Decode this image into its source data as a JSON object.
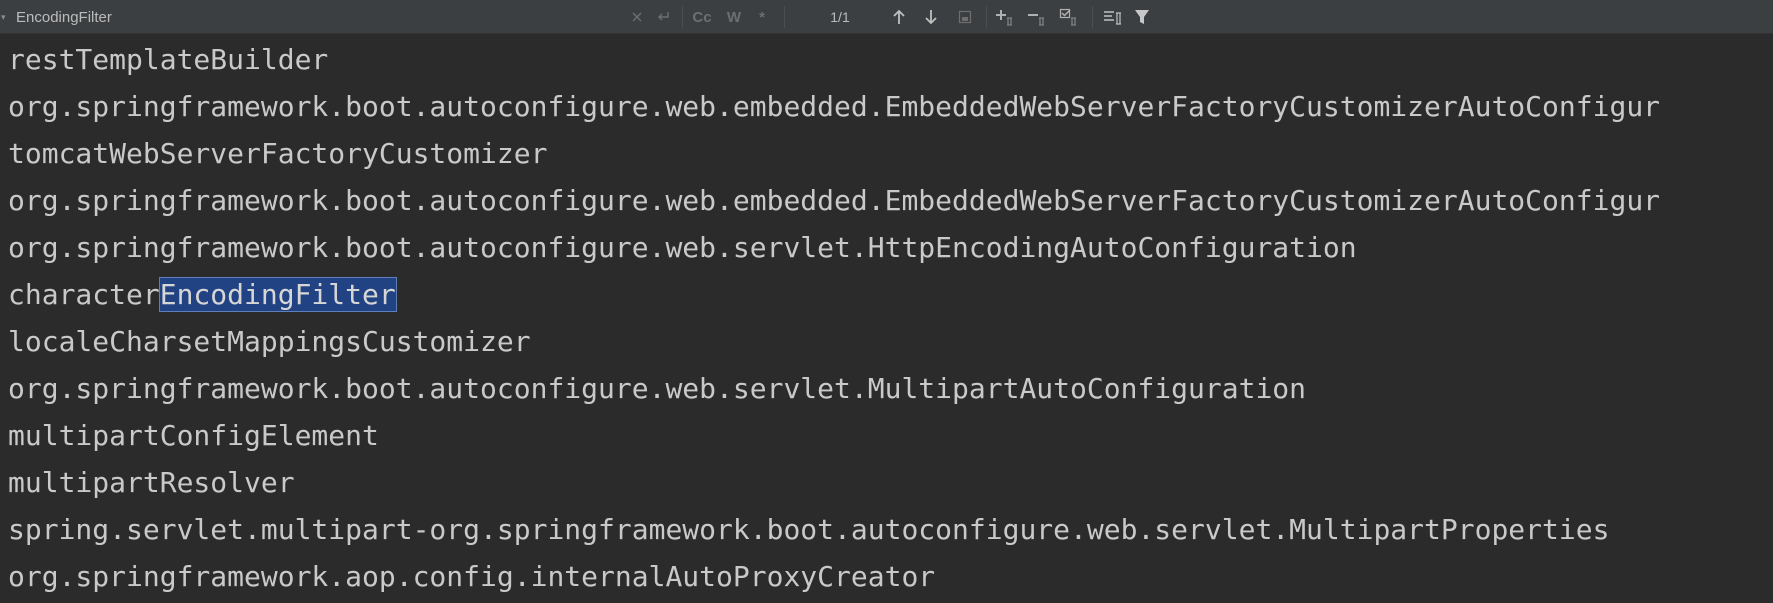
{
  "search": {
    "query": "EncodingFilter",
    "match_count": "1/1"
  },
  "toolbar": {
    "match_case_label": "Cc",
    "words_label": "W",
    "regex_label": "*"
  },
  "lines": [
    {
      "text": "restTemplateBuilder"
    },
    {
      "text": "org.springframework.boot.autoconfigure.web.embedded.EmbeddedWebServerFactoryCustomizerAutoConfigur"
    },
    {
      "text": "tomcatWebServerFactoryCustomizer"
    },
    {
      "text": "org.springframework.boot.autoconfigure.web.embedded.EmbeddedWebServerFactoryCustomizerAutoConfigur"
    },
    {
      "text": "org.springframework.boot.autoconfigure.web.servlet.HttpEncodingAutoConfiguration"
    },
    {
      "before": "character",
      "match": "EncodingFilter",
      "after": ""
    },
    {
      "text": "localeCharsetMappingsCustomizer"
    },
    {
      "text": "org.springframework.boot.autoconfigure.web.servlet.MultipartAutoConfiguration"
    },
    {
      "text": "multipartConfigElement"
    },
    {
      "text": "multipartResolver"
    },
    {
      "text": "spring.servlet.multipart-org.springframework.boot.autoconfigure.web.servlet.MultipartProperties"
    },
    {
      "text": "org.springframework.aop.config.internalAutoProxyCreator"
    }
  ],
  "colors": {
    "editor_bg": "#2b2b2b",
    "toolbar_bg": "#3c3f41",
    "text": "#c9c9c9",
    "match_highlight": "#214283"
  }
}
